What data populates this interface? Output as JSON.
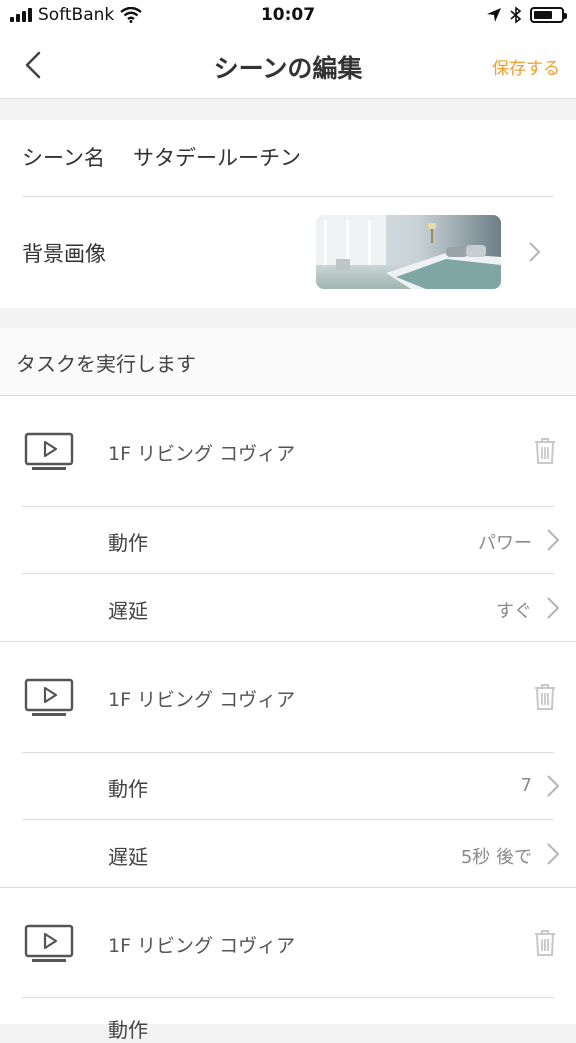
{
  "status_bar": {
    "carrier": "SoftBank",
    "time": "10:07",
    "battery_level": 0.7
  },
  "nav": {
    "title": "シーンの編集",
    "save_label": "保存する"
  },
  "scene": {
    "name_label": "シーン名",
    "name_value": "サタデールーチン",
    "background_label": "背景画像"
  },
  "tasks_header": "タスクを実行します",
  "tasks": [
    {
      "device": "1F リビング コヴィア",
      "action_label": "動作",
      "action_value": "パワー",
      "delay_label": "遅延",
      "delay_value": "すぐ"
    },
    {
      "device": "1F リビング コヴィア",
      "action_label": "動作",
      "action_value": "7",
      "delay_label": "遅延",
      "delay_value": "5秒 後で"
    },
    {
      "device": "1F リビング コヴィア",
      "action_label": "動作"
    }
  ],
  "colors": {
    "accent": "#f0a030",
    "background": "#f4f4f4"
  }
}
